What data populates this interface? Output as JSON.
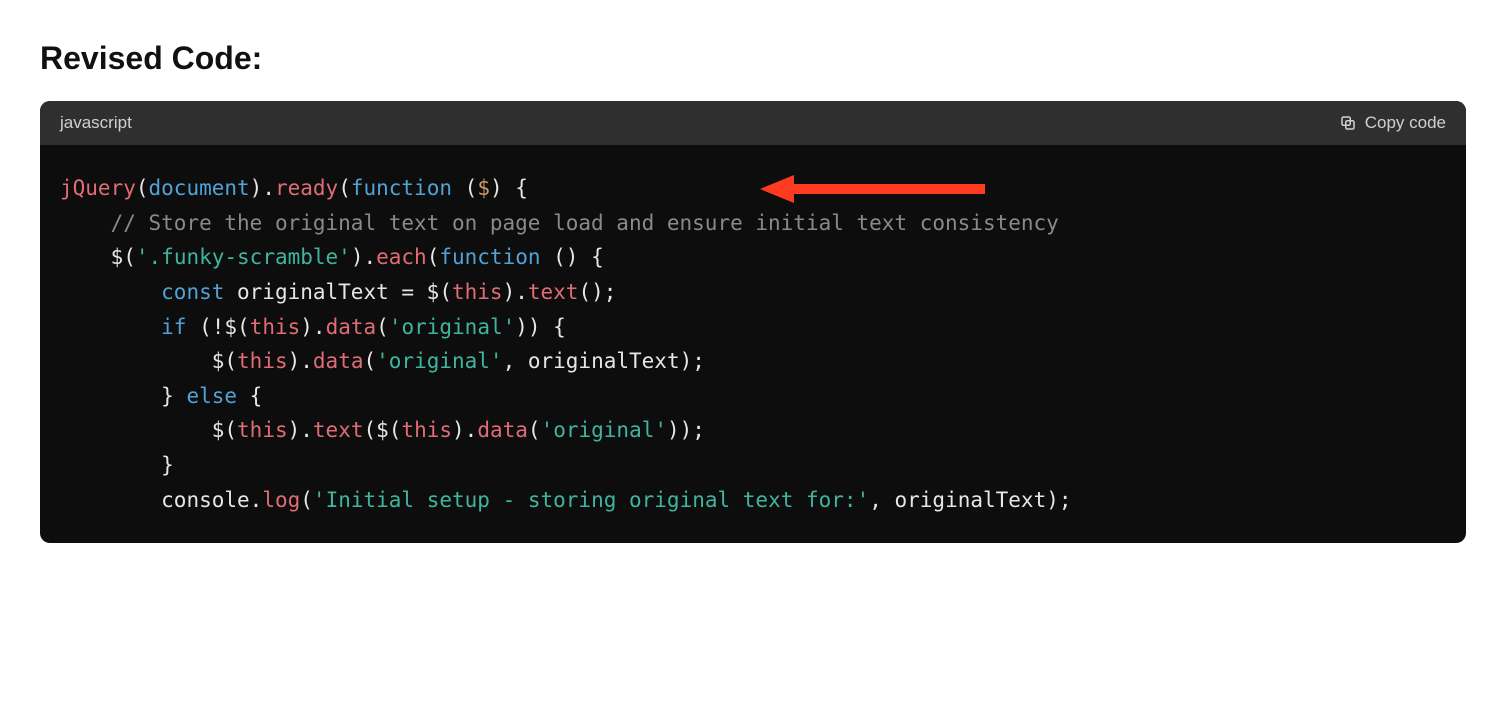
{
  "heading": "Revised Code:",
  "code_block": {
    "language": "javascript",
    "copy_label": "Copy code",
    "lines": [
      [
        {
          "t": "jQuery",
          "c": "red"
        },
        {
          "t": "(",
          "c": "white"
        },
        {
          "t": "document",
          "c": "blue"
        },
        {
          "t": ").",
          "c": "white"
        },
        {
          "t": "ready",
          "c": "red"
        },
        {
          "t": "(",
          "c": "white"
        },
        {
          "t": "function",
          "c": "blue"
        },
        {
          "t": " ",
          "c": "white"
        },
        {
          "t": "(",
          "c": "white"
        },
        {
          "t": "$",
          "c": "orange"
        },
        {
          "t": ")",
          "c": "white"
        },
        {
          "t": " {",
          "c": "white"
        }
      ],
      [
        {
          "t": "    ",
          "c": "white"
        },
        {
          "t": "// Store the original text on page load and ensure initial text consistency",
          "c": "gray"
        }
      ],
      [
        {
          "t": "    ",
          "c": "white"
        },
        {
          "t": "$",
          "c": "white"
        },
        {
          "t": "(",
          "c": "white"
        },
        {
          "t": "'.funky-scramble'",
          "c": "teal"
        },
        {
          "t": ").",
          "c": "white"
        },
        {
          "t": "each",
          "c": "red"
        },
        {
          "t": "(",
          "c": "white"
        },
        {
          "t": "function",
          "c": "blue"
        },
        {
          "t": " () {",
          "c": "white"
        }
      ],
      [
        {
          "t": "        ",
          "c": "white"
        },
        {
          "t": "const",
          "c": "blue"
        },
        {
          "t": " originalText = ",
          "c": "white"
        },
        {
          "t": "$",
          "c": "white"
        },
        {
          "t": "(",
          "c": "white"
        },
        {
          "t": "this",
          "c": "red"
        },
        {
          "t": ").",
          "c": "white"
        },
        {
          "t": "text",
          "c": "red"
        },
        {
          "t": "();",
          "c": "white"
        }
      ],
      [
        {
          "t": "        ",
          "c": "white"
        },
        {
          "t": "if",
          "c": "blue"
        },
        {
          "t": " (!",
          "c": "white"
        },
        {
          "t": "$",
          "c": "white"
        },
        {
          "t": "(",
          "c": "white"
        },
        {
          "t": "this",
          "c": "red"
        },
        {
          "t": ").",
          "c": "white"
        },
        {
          "t": "data",
          "c": "red"
        },
        {
          "t": "(",
          "c": "white"
        },
        {
          "t": "'original'",
          "c": "teal"
        },
        {
          "t": ")) {",
          "c": "white"
        }
      ],
      [
        {
          "t": "            ",
          "c": "white"
        },
        {
          "t": "$",
          "c": "white"
        },
        {
          "t": "(",
          "c": "white"
        },
        {
          "t": "this",
          "c": "red"
        },
        {
          "t": ").",
          "c": "white"
        },
        {
          "t": "data",
          "c": "red"
        },
        {
          "t": "(",
          "c": "white"
        },
        {
          "t": "'original'",
          "c": "teal"
        },
        {
          "t": ", originalText);",
          "c": "white"
        }
      ],
      [
        {
          "t": "        } ",
          "c": "white"
        },
        {
          "t": "else",
          "c": "blue"
        },
        {
          "t": " {",
          "c": "white"
        }
      ],
      [
        {
          "t": "            ",
          "c": "white"
        },
        {
          "t": "$",
          "c": "white"
        },
        {
          "t": "(",
          "c": "white"
        },
        {
          "t": "this",
          "c": "red"
        },
        {
          "t": ").",
          "c": "white"
        },
        {
          "t": "text",
          "c": "red"
        },
        {
          "t": "(",
          "c": "white"
        },
        {
          "t": "$",
          "c": "white"
        },
        {
          "t": "(",
          "c": "white"
        },
        {
          "t": "this",
          "c": "red"
        },
        {
          "t": ").",
          "c": "white"
        },
        {
          "t": "data",
          "c": "red"
        },
        {
          "t": "(",
          "c": "white"
        },
        {
          "t": "'original'",
          "c": "teal"
        },
        {
          "t": "));",
          "c": "white"
        }
      ],
      [
        {
          "t": "        }",
          "c": "white"
        }
      ],
      [
        {
          "t": "        ",
          "c": "white"
        },
        {
          "t": "console",
          "c": "white"
        },
        {
          "t": ".",
          "c": "white"
        },
        {
          "t": "log",
          "c": "red"
        },
        {
          "t": "(",
          "c": "white"
        },
        {
          "t": "'Initial setup - storing original text for:'",
          "c": "teal"
        },
        {
          "t": ", originalText);",
          "c": "white"
        }
      ]
    ]
  },
  "annotation": {
    "type": "arrow",
    "color": "#ff3b1f"
  }
}
